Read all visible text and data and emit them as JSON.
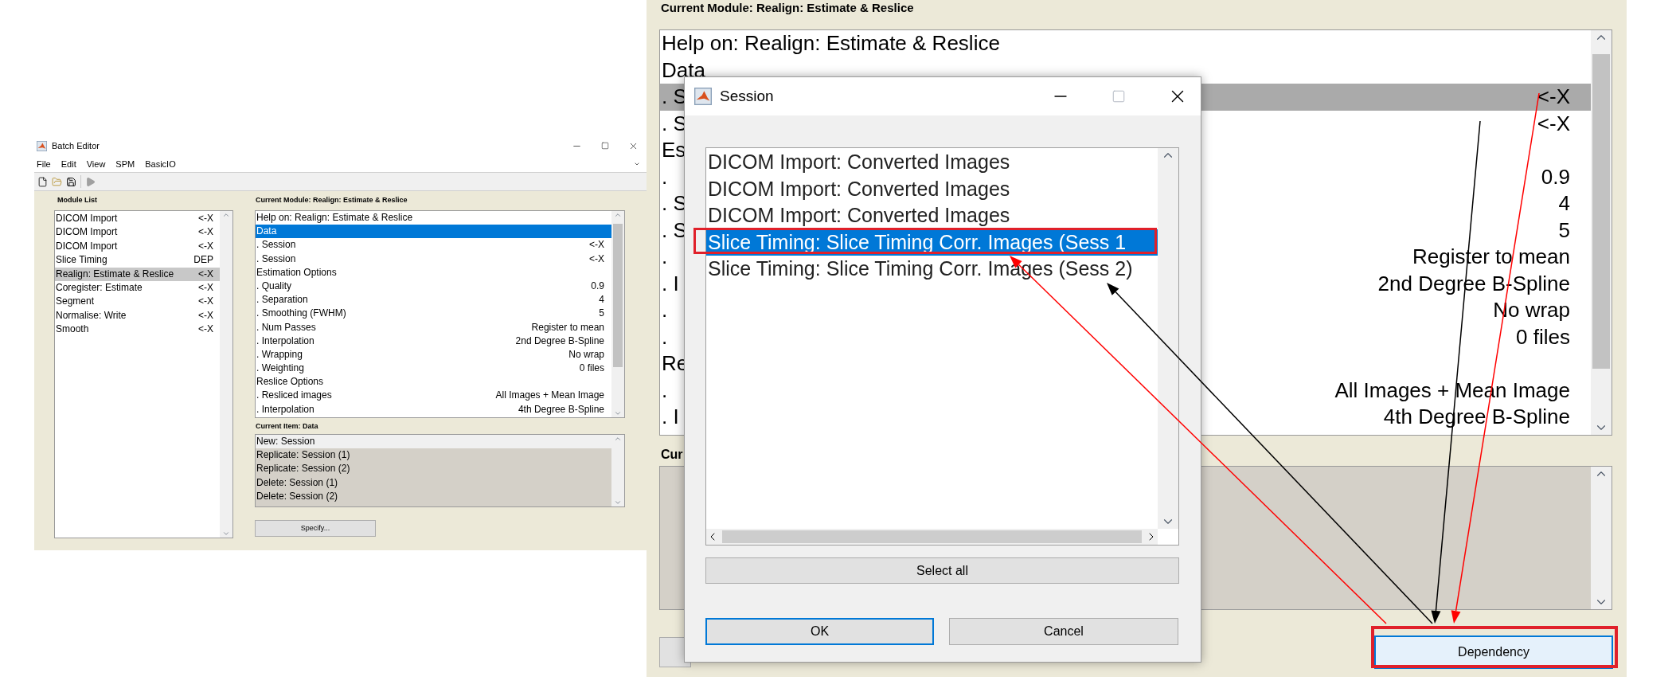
{
  "batch_editor": {
    "title": "Batch Editor",
    "menu": [
      "File",
      "Edit",
      "View",
      "SPM",
      "BasicIO"
    ],
    "module_list": {
      "label": "Module List",
      "items": [
        {
          "name": "DICOM Import",
          "status": "<-X",
          "selected": false
        },
        {
          "name": "DICOM Import",
          "status": "<-X",
          "selected": false
        },
        {
          "name": "DICOM Import",
          "status": "<-X",
          "selected": false
        },
        {
          "name": "Slice Timing",
          "status": "DEP",
          "selected": false
        },
        {
          "name": "Realign: Estimate & Reslice",
          "status": "<-X",
          "selected": true
        },
        {
          "name": "Coregister: Estimate",
          "status": "<-X",
          "selected": false
        },
        {
          "name": "Segment",
          "status": "<-X",
          "selected": false
        },
        {
          "name": "Normalise: Write",
          "status": "<-X",
          "selected": false
        },
        {
          "name": "Smooth",
          "status": "<-X",
          "selected": false
        }
      ]
    },
    "current_module": {
      "label": "Current Module: Realign: Estimate & Reslice",
      "items": [
        {
          "label": "Help on: Realign: Estimate & Reslice",
          "selected": false
        },
        {
          "label": "Data",
          "selected": true
        },
        {
          "label": ". Session",
          "value": "<-X",
          "selected": false
        },
        {
          "label": ". Session",
          "value": "<-X",
          "selected": false
        },
        {
          "label": "Estimation Options",
          "selected": false
        },
        {
          "label": ". Quality",
          "value": "0.9",
          "selected": false
        },
        {
          "label": ". Separation",
          "value": "4",
          "selected": false
        },
        {
          "label": ". Smoothing (FWHM)",
          "value": "5",
          "selected": false
        },
        {
          "label": ". Num Passes",
          "value": "Register to mean",
          "selected": false
        },
        {
          "label": ". Interpolation",
          "value": "2nd Degree B-Spline",
          "selected": false
        },
        {
          "label": ". Wrapping",
          "value": "No wrap",
          "selected": false
        },
        {
          "label": ". Weighting",
          "value": "0 files",
          "selected": false
        },
        {
          "label": "Reslice Options",
          "selected": false
        },
        {
          "label": ". Resliced images",
          "value": "All Images + Mean Image",
          "selected": false
        },
        {
          "label": ". Interpolation",
          "value": "4th Degree B-Spline",
          "selected": false
        }
      ]
    },
    "current_item": {
      "label": "Current Item: Data",
      "items": [
        {
          "label": "New: Session",
          "selected": true
        },
        {
          "label": "Replicate: Session (1)",
          "selected": false
        },
        {
          "label": "Replicate: Session (2)",
          "selected": false
        },
        {
          "label": "Delete: Session (1)",
          "selected": false
        },
        {
          "label": "Delete: Session (2)",
          "selected": false
        }
      ]
    },
    "specify_button": "Specify..."
  },
  "zoomed_view": {
    "module_label": "Current Module: Realign: Estimate & Reslice",
    "items": [
      {
        "label": "Help on: Realign: Estimate & Reslice",
        "selected": false
      },
      {
        "label": "Data",
        "selected": false
      },
      {
        "label": ". S",
        "value": "<-X",
        "selected": true
      },
      {
        "label": ". S",
        "value": "<-X",
        "selected": false
      },
      {
        "label": "Es",
        "selected": false
      },
      {
        "label": ".",
        "value": "0.9",
        "selected": false
      },
      {
        "label": ". S",
        "value": "4",
        "selected": false
      },
      {
        "label": ". S",
        "value": "5",
        "selected": false
      },
      {
        "label": ".",
        "value": "Register to mean",
        "selected": false
      },
      {
        "label": ". I",
        "value": "2nd Degree B-Spline",
        "selected": false
      },
      {
        "label": ".",
        "value": "No wrap",
        "selected": false
      },
      {
        "label": ".",
        "value": "0 files",
        "selected": false
      },
      {
        "label": "Re",
        "selected": false
      },
      {
        "label": ".",
        "value": "All Images + Mean Image",
        "selected": false
      },
      {
        "label": ". I",
        "value": "4th Degree B-Spline",
        "selected": false
      }
    ],
    "item_label": "Cur",
    "dependency_button": "Dependency"
  },
  "session_dialog": {
    "title": "Session",
    "items": [
      {
        "label": "DICOM Import: Converted Images",
        "selected": false
      },
      {
        "label": "DICOM Import: Converted Images",
        "selected": false
      },
      {
        "label": "DICOM Import: Converted Images",
        "selected": false
      },
      {
        "label": "Slice Timing: Slice Timing Corr. Images (Sess 1",
        "selected": true
      },
      {
        "label": "Slice Timing: Slice Timing Corr. Images (Sess 2)",
        "selected": false
      }
    ],
    "select_all": "Select all",
    "ok": "OK",
    "cancel": "Cancel"
  }
}
